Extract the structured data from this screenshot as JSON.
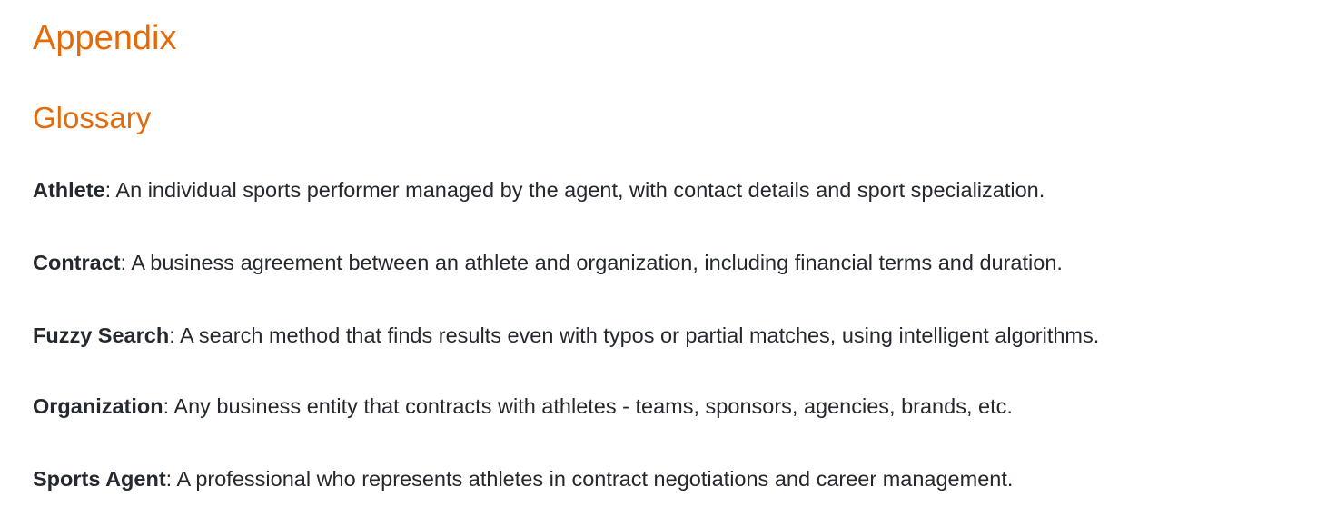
{
  "appendix": {
    "title": "Appendix",
    "glossary": {
      "title": "Glossary",
      "entries": [
        {
          "term": "Athlete",
          "separator": ": ",
          "definition": "An individual sports performer managed by the agent, with contact details and sport specialization."
        },
        {
          "term": "Contract",
          "separator": ": ",
          "definition": "A business agreement between an athlete and organization, including financial terms and duration."
        },
        {
          "term": "Fuzzy Search",
          "separator": ": ",
          "definition": "A search method that finds results even with typos or partial matches, using intelligent algorithms."
        },
        {
          "term": "Organization",
          "separator": ": ",
          "definition": "Any business entity that contracts with athletes - teams, sponsors, agencies, brands, etc."
        },
        {
          "term": "Sports Agent",
          "separator": ": ",
          "definition": "A professional who represents athletes in contract negotiations and career management."
        }
      ]
    }
  },
  "colors": {
    "heading": "#e36b0a",
    "body_text": "#24292f"
  }
}
